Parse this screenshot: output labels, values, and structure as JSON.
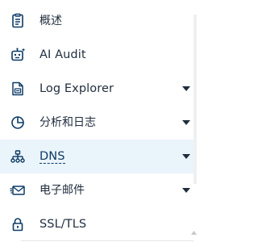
{
  "sidebar": {
    "items": [
      {
        "label": "概述",
        "icon": "document-icon",
        "expandable": false,
        "active": false
      },
      {
        "label": "AI Audit",
        "icon": "robot-icon",
        "expandable": false,
        "active": false
      },
      {
        "label": "Log Explorer",
        "icon": "log-explorer-icon",
        "expandable": true,
        "active": false
      },
      {
        "label": "分析和日志",
        "icon": "pie-chart-icon",
        "expandable": true,
        "active": false
      },
      {
        "label": "DNS",
        "icon": "network-hierarchy-icon",
        "expandable": true,
        "active": true
      },
      {
        "label": "电子邮件",
        "icon": "email-icon",
        "expandable": true,
        "active": false
      },
      {
        "label": "SSL/TLS",
        "icon": "lock-icon",
        "expandable": true,
        "active": false
      }
    ]
  },
  "colors": {
    "icon": "#0d3b66",
    "text": "#1f2d3d",
    "active_background": "#eaf4fb",
    "chevron": "#1f2d3d"
  }
}
